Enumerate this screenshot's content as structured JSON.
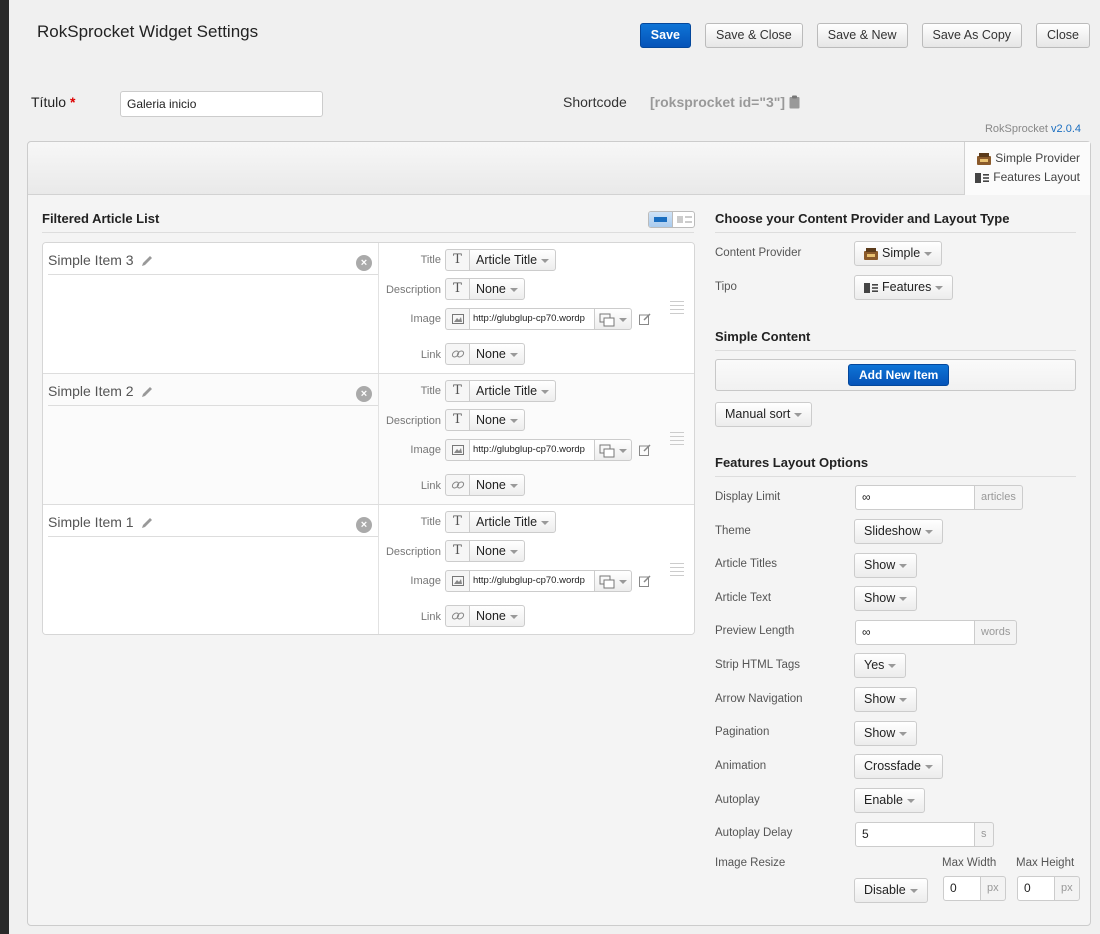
{
  "header": {
    "title": "RokSprocket Widget Settings",
    "buttons": {
      "save": "Save",
      "save_close": "Save & Close",
      "save_new": "Save & New",
      "save_copy": "Save As Copy",
      "close": "Close"
    }
  },
  "form": {
    "titulo_label": "Título",
    "required_mark": "*",
    "titulo_value": "Galeria inicio",
    "shortcode_label": "Shortcode",
    "shortcode_value": "[roksprocket id=\"3\"]"
  },
  "version": {
    "name": "RokSprocket",
    "number": "v2.0.4"
  },
  "provider_box": {
    "provider": "Simple Provider",
    "layout": "Features Layout"
  },
  "article_list": {
    "title": "Filtered Article List",
    "field_labels": {
      "title": "Title",
      "description": "Description",
      "image": "Image",
      "link": "Link"
    },
    "items": [
      {
        "name": "Simple Item 3",
        "title_value": "Article Title",
        "description_value": "None",
        "image_url": "http://glubglup-cp70.wordp",
        "link_value": "None"
      },
      {
        "name": "Simple Item 2",
        "title_value": "Article Title",
        "description_value": "None",
        "image_url": "http://glubglup-cp70.wordp",
        "link_value": "None"
      },
      {
        "name": "Simple Item 1",
        "title_value": "Article Title",
        "description_value": "None",
        "image_url": "http://glubglup-cp70.wordp",
        "link_value": "None"
      }
    ]
  },
  "content_provider": {
    "title": "Choose your Content Provider and Layout Type",
    "provider_label": "Content Provider",
    "provider_value": "Simple",
    "type_label": "Tipo",
    "type_value": "Features"
  },
  "simple_content": {
    "title": "Simple Content",
    "add_button": "Add New Item",
    "sort_value": "Manual sort"
  },
  "layout_options": {
    "title": "Features Layout Options",
    "display_limit": {
      "label": "Display Limit",
      "value": "∞",
      "unit": "articles"
    },
    "theme": {
      "label": "Theme",
      "value": "Slideshow"
    },
    "article_titles": {
      "label": "Article Titles",
      "value": "Show"
    },
    "article_text": {
      "label": "Article Text",
      "value": "Show"
    },
    "preview_length": {
      "label": "Preview Length",
      "value": "∞",
      "unit": "words"
    },
    "strip_html": {
      "label": "Strip HTML Tags",
      "value": "Yes"
    },
    "arrow_navigation": {
      "label": "Arrow Navigation",
      "value": "Show"
    },
    "pagination": {
      "label": "Pagination",
      "value": "Show"
    },
    "animation": {
      "label": "Animation",
      "value": "Crossfade"
    },
    "autoplay": {
      "label": "Autoplay",
      "value": "Enable"
    },
    "autoplay_delay": {
      "label": "Autoplay Delay",
      "value": "5",
      "unit": "s"
    },
    "image_resize": {
      "label": "Image Resize",
      "value": "Disable",
      "max_width_label": "Max Width",
      "max_width_value": "0",
      "max_height_label": "Max Height",
      "max_height_value": "0",
      "unit": "px"
    }
  }
}
